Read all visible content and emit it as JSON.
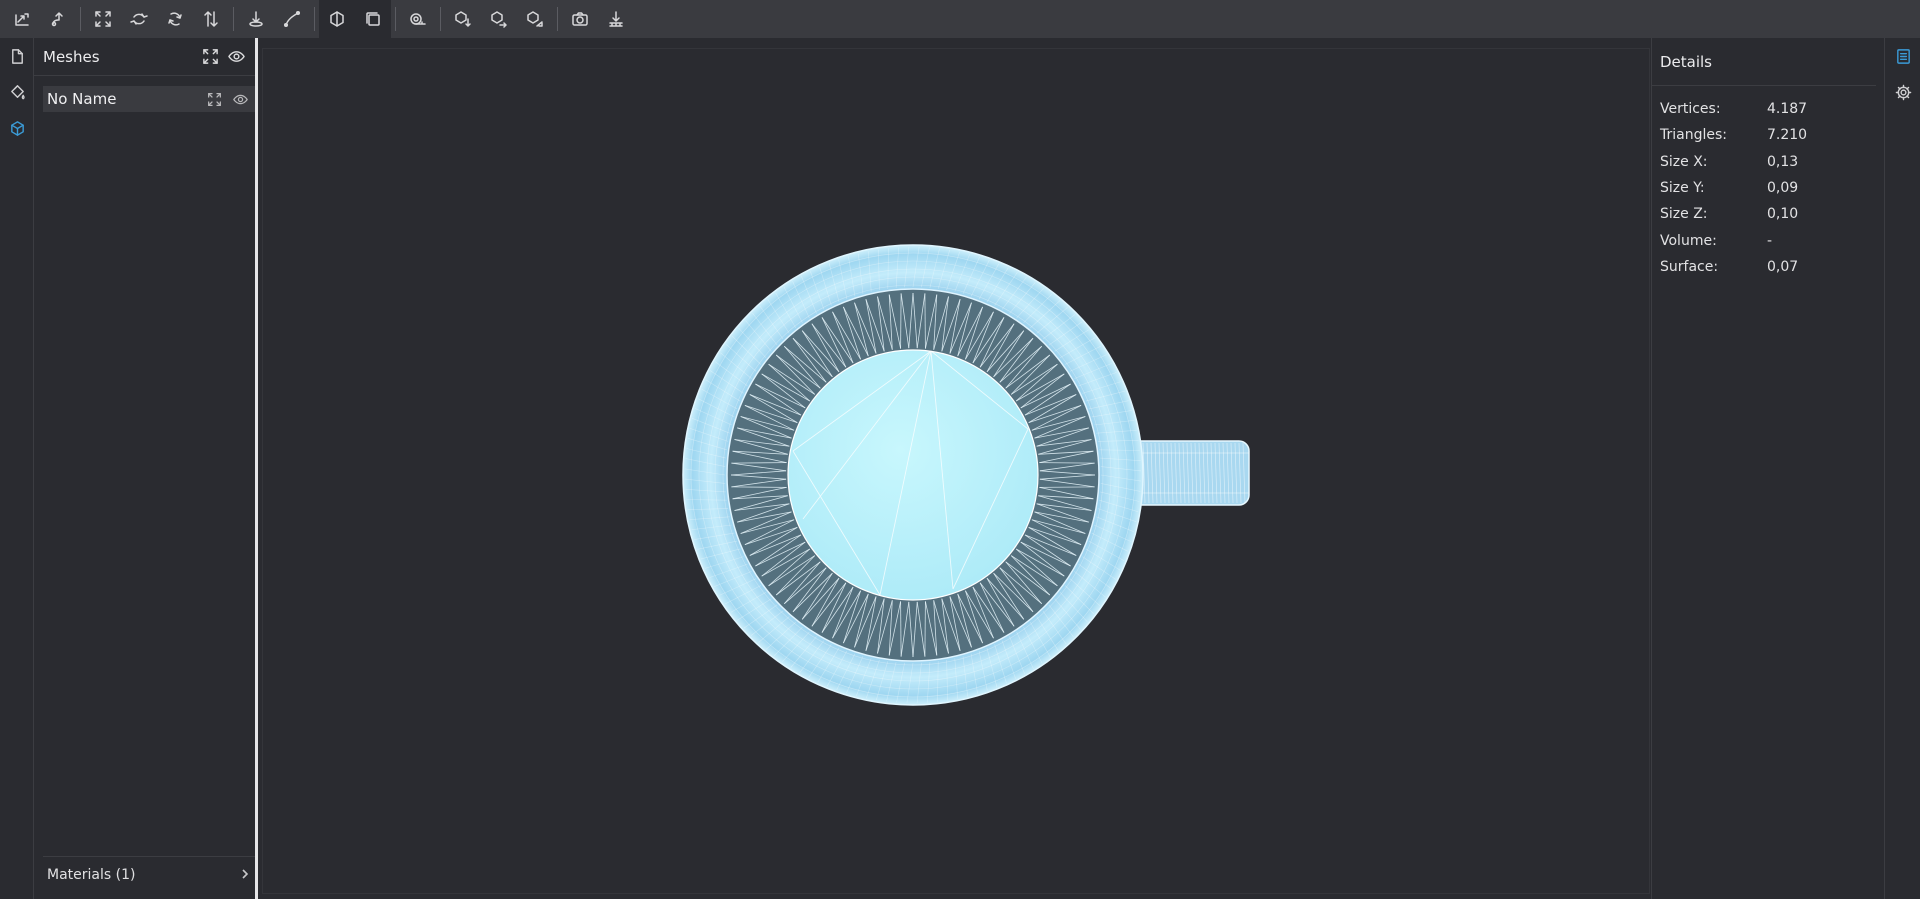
{
  "toolbar": {
    "icons": [
      "export-icon",
      "import-icon",
      "fit-icon",
      "rotate-x-icon",
      "rotate-y-icon",
      "flip-icon",
      "set-origin-icon",
      "curve-icon",
      "solid-view-icon",
      "wireframe-view-icon",
      "measure-icon",
      "view-down-icon",
      "view-right-icon",
      "view-iso-icon",
      "screenshot-icon",
      "ground-icon"
    ]
  },
  "meshes": {
    "title": "Meshes",
    "items": [
      {
        "name": "No Name"
      }
    ],
    "materials_label": "Materials (1)"
  },
  "details": {
    "title": "Details",
    "stats": [
      {
        "label": "Vertices:",
        "value": "4.187"
      },
      {
        "label": "Triangles:",
        "value": "7.210"
      },
      {
        "label": "Size X:",
        "value": "0,13"
      },
      {
        "label": "Size Y:",
        "value": "0,09"
      },
      {
        "label": "Size Z:",
        "value": "0,10"
      },
      {
        "label": "Volume:",
        "value": "-"
      },
      {
        "label": "Surface:",
        "value": "0,07"
      }
    ]
  },
  "colors": {
    "accent": "#3b9bd6",
    "mesh_fill": "#bdf1fb",
    "mesh_inner_wall": "#54707e"
  }
}
